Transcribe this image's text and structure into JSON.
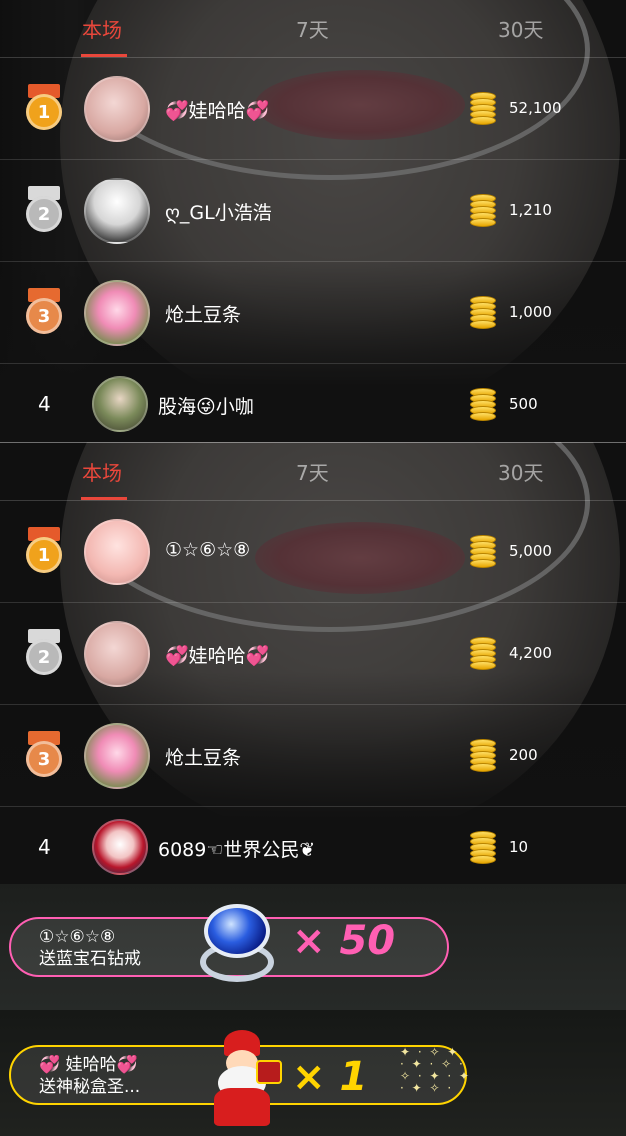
{
  "panels": [
    {
      "tabs": [
        "本场",
        "7天",
        "30天"
      ],
      "active_tab": 0,
      "rows": [
        {
          "rank": "1",
          "name": "💞娃哈哈💞",
          "score": "52,100"
        },
        {
          "rank": "2",
          "name": "ღ_GL小浩浩",
          "score": "1,210"
        },
        {
          "rank": "3",
          "name": "炝土豆条",
          "score": "1,000"
        },
        {
          "rank": "4",
          "name": "股海😜小咖",
          "score": "500"
        }
      ]
    },
    {
      "tabs": [
        "本场",
        "7天",
        "30天"
      ],
      "active_tab": 0,
      "rows": [
        {
          "rank": "1",
          "name": "①☆⑥☆⑧",
          "score": "5,000"
        },
        {
          "rank": "2",
          "name": "💞娃哈哈💞",
          "score": "4,200"
        },
        {
          "rank": "3",
          "name": "炝土豆条",
          "score": "200"
        },
        {
          "rank": "4",
          "name": "6089☜世界公民❦",
          "score": "10"
        }
      ]
    }
  ],
  "gifts": [
    {
      "sender": "①☆⑥☆⑧",
      "action": "送蓝宝石钻戒",
      "count": "× 50",
      "icon": "sapphire-ring-icon",
      "accent": "#ff5fb3"
    },
    {
      "sender": "💞 娃哈哈💞",
      "action": "送神秘盒圣...",
      "count": "× 1",
      "icon": "santa-claus-icon",
      "accent": "#ffd400"
    }
  ],
  "colors": {
    "active_tab": "#e9473b",
    "gold_medal": "#f0a21c",
    "silver_medal": "#b9b9b9",
    "bronze_medal": "#e7894a",
    "coin": "#f5c400"
  }
}
